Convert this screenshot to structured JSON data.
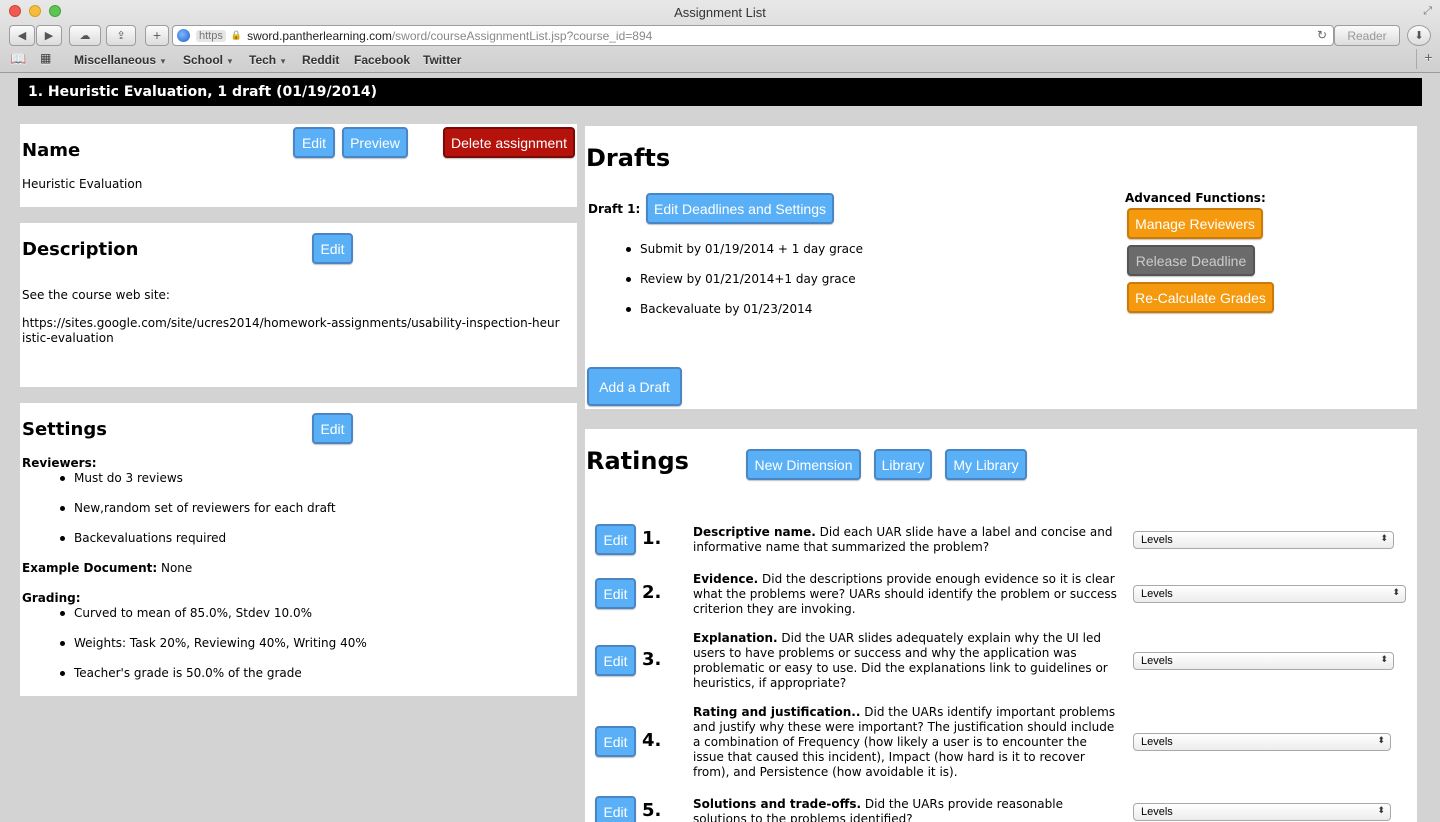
{
  "browser": {
    "window_title": "Assignment List",
    "url_scheme": "https",
    "url_host": "sword.pantherlearning.com",
    "url_path": "/sword/courseAssignmentList.jsp?course_id=894",
    "reader_label": "Reader",
    "bookmarks": [
      {
        "label": "Miscellaneous",
        "has_menu": true
      },
      {
        "label": "School",
        "has_menu": true
      },
      {
        "label": "Tech",
        "has_menu": true
      },
      {
        "label": "Reddit",
        "has_menu": false
      },
      {
        "label": "Facebook",
        "has_menu": false
      },
      {
        "label": "Twitter",
        "has_menu": false
      }
    ]
  },
  "assignment_header": "1. Heuristic Evaluation, 1 draft (01/19/2014)",
  "name_panel": {
    "heading": "Name",
    "edit_label": "Edit",
    "preview_label": "Preview",
    "delete_label": "Delete assignment",
    "value": "Heuristic Evaluation"
  },
  "description_panel": {
    "heading": "Description",
    "edit_label": "Edit",
    "line1": "See the course web site:",
    "link": "https://sites.google.com/site/ucres2014/homework-assignments/usability-inspection-heuristic-evaluation"
  },
  "settings_panel": {
    "heading": "Settings",
    "edit_label": "Edit",
    "reviewers_label": "Reviewers:",
    "reviewers": [
      "Must do 3 reviews",
      "New,random set of reviewers for each draft",
      "Backevaluations required"
    ],
    "example_label": "Example Document:",
    "example_value": "None",
    "grading_label": "Grading:",
    "grading": [
      "Curved to mean of 85.0%, Stdev 10.0%",
      "Weights: Task 20%, Reviewing 40%, Writing 40%",
      "Teacher's grade is 50.0% of the grade"
    ]
  },
  "drafts_panel": {
    "heading": "Drafts",
    "draft_label": "Draft 1:",
    "edit_deadlines_label": "Edit Deadlines and Settings",
    "deadlines": [
      "Submit by 01/19/2014 + 1 day grace",
      "Review by 01/21/2014+1 day grace",
      "Backevaluate by 01/23/2014"
    ],
    "add_draft_label": "Add a Draft",
    "advanced_label": "Advanced Functions:",
    "manage_reviewers_label": "Manage Reviewers",
    "release_deadline_label": "Release Deadline",
    "recalculate_label": "Re-Calculate Grades"
  },
  "ratings_panel": {
    "heading": "Ratings",
    "new_dimension_label": "New Dimension",
    "library_label": "Library",
    "my_library_label": "My Library",
    "items": [
      {
        "number": "1.",
        "edit": "Edit",
        "title": "Descriptive name.",
        "text": "Did each UAR slide have a label and concise and informative name that summarized the problem?",
        "select": "Levels"
      },
      {
        "number": "2.",
        "edit": "Edit",
        "title": "Evidence.",
        "text": "Did the descriptions provide enough evidence so it is clear what the problems were? UARs should identify the problem or success criterion they are invoking.",
        "select": "Levels"
      },
      {
        "number": "3.",
        "edit": "Edit",
        "title": "Explanation.",
        "text": "Did the UAR slides adequately explain why the UI led users to have problems or success and why the application was problematic or easy to use. Did the explanations link to guidelines or heuristics, if appropriate?",
        "select": "Levels"
      },
      {
        "number": "4.",
        "edit": "Edit",
        "title": "Rating and justification..",
        "text": "Did the UARs identify important problems and justify why these were important? The justification should include a combination of Frequency (how likely a user is to encounter the issue that caused this incident), Impact (how hard is it to recover from), and Persistence (how avoidable it is).",
        "select": "Levels"
      },
      {
        "number": "5.",
        "edit": "Edit",
        "title": "Solutions and trade-offs.",
        "text": "Did the UARs provide reasonable solutions to the problems identified?",
        "select": "Levels"
      }
    ]
  }
}
